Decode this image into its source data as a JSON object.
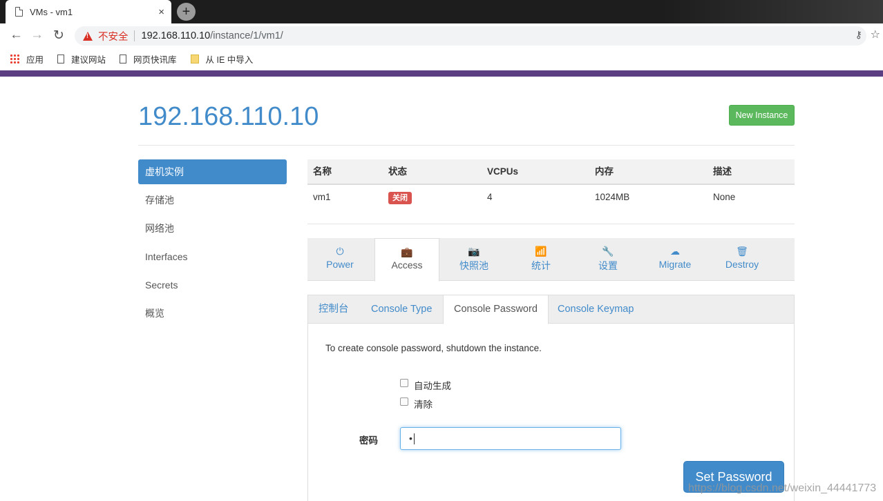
{
  "browser": {
    "tab_title": "VMs - vm1",
    "tab_close": "×",
    "new_tab": "+",
    "back": "←",
    "forward": "→",
    "reload": "↻",
    "insecure_label": "不安全",
    "url_host": "192.168.110.10",
    "url_path": "/instance/1/vm1/",
    "bookmarks": [
      "应用",
      "建议网站",
      "网页快讯库",
      "从 IE 中导入"
    ]
  },
  "header": {
    "title": "192.168.110.10",
    "new_instance": "New Instance"
  },
  "sidebar": {
    "items": [
      "虚机实例",
      "存储池",
      "网络池",
      "Interfaces",
      "Secrets",
      "概览"
    ]
  },
  "vm_table": {
    "headers": [
      "名称",
      "状态",
      "VCPUs",
      "内存",
      "描述"
    ],
    "row": {
      "name": "vm1",
      "status": "关闭",
      "vcpus": "4",
      "memory": "1024MB",
      "description": "None"
    }
  },
  "action_tabs": [
    {
      "label": "Power",
      "icon": "⏻"
    },
    {
      "label": "Access",
      "icon": "💼"
    },
    {
      "label": "快照池",
      "icon": "📷"
    },
    {
      "label": "统计",
      "icon": "📶"
    },
    {
      "label": "设置",
      "icon": "🔧"
    },
    {
      "label": "Migrate",
      "icon": "☁"
    },
    {
      "label": "Destroy",
      "icon": "🗑"
    }
  ],
  "access_tabs": [
    "控制台",
    "Console Type",
    "Console Password",
    "Console Keymap"
  ],
  "console_password": {
    "info": "To create console password, shutdown the instance.",
    "auto_generate": "自动生成",
    "clear": "清除",
    "password_label": "密码",
    "password_value": "•",
    "submit": "Set Password"
  },
  "watermark": "https://blog.csdn.net/weixin_44441773",
  "colors": {
    "primary": "#428bca",
    "success": "#5cb85c",
    "danger": "#d9534f",
    "header_bar": "#5c3f83"
  }
}
